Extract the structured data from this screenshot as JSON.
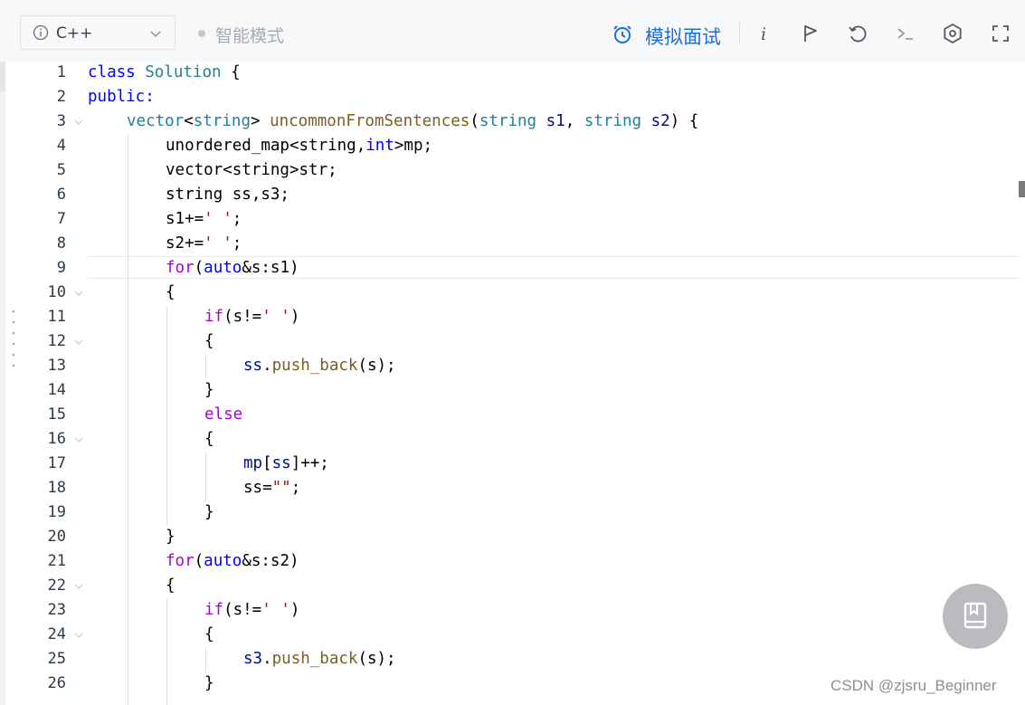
{
  "toolbar": {
    "language": "C++",
    "mode_label": "智能模式",
    "mock_interview_label": "模拟面试",
    "icons": [
      "info-icon",
      "flag-icon",
      "reset-icon",
      "terminal-icon",
      "settings-icon",
      "fullscreen-icon"
    ]
  },
  "editor": {
    "lines": [
      {
        "n": "1",
        "fold": false,
        "indent": 0,
        "tokens": [
          [
            "kw",
            "class"
          ],
          [
            "pl",
            " "
          ],
          [
            "ty",
            "Solution"
          ],
          [
            "pl",
            " {"
          ]
        ]
      },
      {
        "n": "2",
        "fold": false,
        "indent": 0,
        "tokens": [
          [
            "kw",
            "public:"
          ]
        ]
      },
      {
        "n": "3",
        "fold": true,
        "indent": 1,
        "tokens": [
          [
            "ty",
            "vector"
          ],
          [
            "pl",
            "<"
          ],
          [
            "ty",
            "string"
          ],
          [
            "pl",
            "> "
          ],
          [
            "fn",
            "uncommonFromSentences"
          ],
          [
            "pl",
            "("
          ],
          [
            "ty",
            "string"
          ],
          [
            "pl",
            " "
          ],
          [
            "par",
            "s1"
          ],
          [
            "pl",
            ", "
          ],
          [
            "ty",
            "string"
          ],
          [
            "pl",
            " "
          ],
          [
            "par",
            "s2"
          ],
          [
            "pl",
            ") {"
          ]
        ]
      },
      {
        "n": "4",
        "fold": false,
        "indent": 2,
        "tokens": [
          [
            "pl",
            "unordered_map<string,"
          ],
          [
            "kw",
            "int"
          ],
          [
            "pl",
            ">mp;"
          ]
        ]
      },
      {
        "n": "5",
        "fold": false,
        "indent": 2,
        "tokens": [
          [
            "pl",
            "vector<string>str;"
          ]
        ]
      },
      {
        "n": "6",
        "fold": false,
        "indent": 2,
        "tokens": [
          [
            "pl",
            "string ss,s3;"
          ]
        ]
      },
      {
        "n": "7",
        "fold": false,
        "indent": 2,
        "tokens": [
          [
            "pl",
            "s1+="
          ],
          [
            "str",
            "' '"
          ],
          [
            "pl",
            ";"
          ]
        ]
      },
      {
        "n": "8",
        "fold": false,
        "indent": 2,
        "tokens": [
          [
            "pl",
            "s2+="
          ],
          [
            "str",
            "' '"
          ],
          [
            "pl",
            ";"
          ]
        ]
      },
      {
        "n": "9",
        "fold": false,
        "indent": 2,
        "tokens": [
          [
            "ctl",
            "for"
          ],
          [
            "pl",
            "("
          ],
          [
            "kw",
            "auto"
          ],
          [
            "pl",
            "&s:s1"
          ],
          [
            "pl",
            ")"
          ]
        ]
      },
      {
        "n": "10",
        "fold": true,
        "indent": 2,
        "tokens": [
          [
            "pl",
            "{"
          ]
        ]
      },
      {
        "n": "11",
        "fold": false,
        "indent": 3,
        "tokens": [
          [
            "ctl",
            "if"
          ],
          [
            "pl",
            "(s!="
          ],
          [
            "str",
            "' '"
          ],
          [
            "pl",
            ")"
          ]
        ]
      },
      {
        "n": "12",
        "fold": true,
        "indent": 3,
        "tokens": [
          [
            "pl",
            "{"
          ]
        ]
      },
      {
        "n": "13",
        "fold": false,
        "indent": 4,
        "tokens": [
          [
            "par",
            "ss"
          ],
          [
            "pl",
            "."
          ],
          [
            "fn",
            "push_back"
          ],
          [
            "pl",
            "(s);"
          ]
        ]
      },
      {
        "n": "14",
        "fold": false,
        "indent": 3,
        "tokens": [
          [
            "pl",
            "}"
          ]
        ]
      },
      {
        "n": "15",
        "fold": false,
        "indent": 3,
        "tokens": [
          [
            "ctl",
            "else"
          ]
        ]
      },
      {
        "n": "16",
        "fold": true,
        "indent": 3,
        "tokens": [
          [
            "pl",
            "{"
          ]
        ]
      },
      {
        "n": "17",
        "fold": false,
        "indent": 4,
        "tokens": [
          [
            "par",
            "mp"
          ],
          [
            "pl",
            "["
          ],
          [
            "par",
            "ss"
          ],
          [
            "pl",
            "]++;"
          ]
        ]
      },
      {
        "n": "18",
        "fold": false,
        "indent": 4,
        "tokens": [
          [
            "pl",
            "ss="
          ],
          [
            "str",
            "\"\""
          ],
          [
            "pl",
            ";"
          ]
        ]
      },
      {
        "n": "19",
        "fold": false,
        "indent": 3,
        "tokens": [
          [
            "pl",
            "}"
          ]
        ]
      },
      {
        "n": "20",
        "fold": false,
        "indent": 2,
        "tokens": [
          [
            "pl",
            "}"
          ]
        ]
      },
      {
        "n": "21",
        "fold": false,
        "indent": 2,
        "tokens": [
          [
            "ctl",
            "for"
          ],
          [
            "pl",
            "("
          ],
          [
            "kw",
            "auto"
          ],
          [
            "pl",
            "&s:s2)"
          ]
        ]
      },
      {
        "n": "22",
        "fold": true,
        "indent": 2,
        "tokens": [
          [
            "pl",
            "{"
          ]
        ]
      },
      {
        "n": "23",
        "fold": false,
        "indent": 3,
        "tokens": [
          [
            "ctl",
            "if"
          ],
          [
            "pl",
            "(s!="
          ],
          [
            "str",
            "' '"
          ],
          [
            "pl",
            ")"
          ]
        ]
      },
      {
        "n": "24",
        "fold": true,
        "indent": 3,
        "tokens": [
          [
            "pl",
            "{"
          ]
        ]
      },
      {
        "n": "25",
        "fold": false,
        "indent": 4,
        "tokens": [
          [
            "par",
            "s3"
          ],
          [
            "pl",
            "."
          ],
          [
            "fn",
            "push_back"
          ],
          [
            "pl",
            "(s);"
          ]
        ]
      },
      {
        "n": "26",
        "fold": false,
        "indent": 3,
        "tokens": [
          [
            "pl",
            "}"
          ]
        ]
      }
    ]
  },
  "watermark": "CSDN @zjsru_Beginner",
  "colors": {
    "accent": "#1e6fd9",
    "keyword": "#0000ff",
    "control": "#af00db",
    "function": "#795e26",
    "type": "#267f99",
    "string": "#a31515"
  }
}
